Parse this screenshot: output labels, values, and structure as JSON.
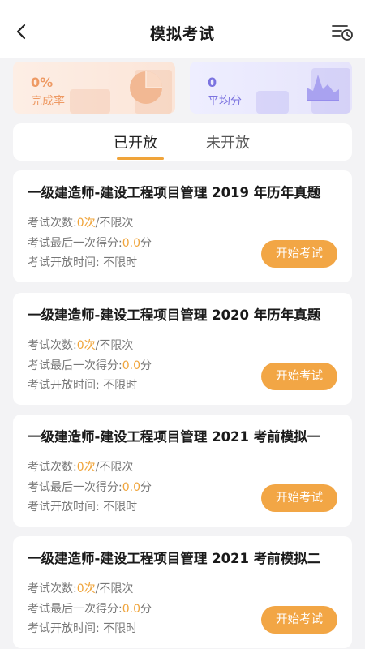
{
  "header": {
    "title": "模拟考试",
    "back_icon": "chevron-left-icon",
    "history_icon": "list-clock-icon"
  },
  "stats": {
    "completion": {
      "value": "0%",
      "label": "完成率",
      "icon": "pie-chart-icon",
      "color": "#ee9a64"
    },
    "average": {
      "value": "0",
      "label": "平均分",
      "icon": "area-chart-icon",
      "color": "#7b73e0"
    }
  },
  "tabs": [
    {
      "label": "已开放",
      "active": true
    },
    {
      "label": "未开放",
      "active": false
    }
  ],
  "colors": {
    "accent": "#f0a43a",
    "button": "#f2a645"
  },
  "exams": [
    {
      "title": "一级建造师-建设工程项目管理 2019 年历年真题",
      "times_label": "考试次数:",
      "times_value": "0次",
      "times_suffix": "/不限次",
      "score_label": "考试最后一次得分:",
      "score_value": "0.0",
      "score_suffix": "分",
      "open_time": "考试开放时间: 不限时",
      "button": "开始考试"
    },
    {
      "title": "一级建造师-建设工程项目管理 2020 年历年真题",
      "times_label": "考试次数:",
      "times_value": "0次",
      "times_suffix": "/不限次",
      "score_label": "考试最后一次得分:",
      "score_value": "0.0",
      "score_suffix": "分",
      "open_time": "考试开放时间: 不限时",
      "button": "开始考试"
    },
    {
      "title": "一级建造师-建设工程项目管理 2021 考前模拟一",
      "times_label": "考试次数:",
      "times_value": "0次",
      "times_suffix": "/不限次",
      "score_label": "考试最后一次得分:",
      "score_value": "0.0",
      "score_suffix": "分",
      "open_time": "考试开放时间: 不限时",
      "button": "开始考试"
    },
    {
      "title": "一级建造师-建设工程项目管理 2021 考前模拟二",
      "times_label": "考试次数:",
      "times_value": "0次",
      "times_suffix": "/不限次",
      "score_label": "考试最后一次得分:",
      "score_value": "0.0",
      "score_suffix": "分",
      "open_time": "考试开放时间: 不限时",
      "button": "开始考试"
    }
  ]
}
